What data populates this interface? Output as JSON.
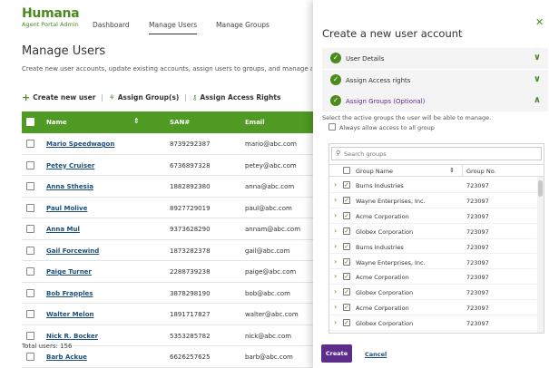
{
  "brand": {
    "name": "Humana",
    "subtitle": "Agent Portal Admin",
    "color": "#4b8b1e"
  },
  "nav": {
    "items": [
      "Dashboard",
      "Manage Users",
      "Manage Groups"
    ],
    "active": "Manage Users"
  },
  "page": {
    "title": "Manage Users",
    "description": "Create new user accounts, update existing accounts, assign users to groups, and manage access r"
  },
  "toolbar": {
    "create_label": "Create new user",
    "assign_groups_label": "Assign Group(s)",
    "assign_rights_label": "Assign Access Rights"
  },
  "table": {
    "headers": {
      "name": "Name",
      "san": "SAN#",
      "email": "Email"
    },
    "rows": [
      {
        "name": "Mario Speedwagon",
        "san": "8739292387",
        "email": "mario@abc.com"
      },
      {
        "name": "Petey Cruiser",
        "san": "6736897328",
        "email": "petey@abc.com"
      },
      {
        "name": "Anna Sthesia",
        "san": "1882892380",
        "email": "anna@abc.com"
      },
      {
        "name": "Paul Molive",
        "san": "8927729019",
        "email": "paul@abc.com"
      },
      {
        "name": "Anna Mul",
        "san": "9373628290",
        "email": "annam@abc.com"
      },
      {
        "name": "Gail Forcewind",
        "san": "1873282378",
        "email": "gail@abc.com"
      },
      {
        "name": "Paige Turner",
        "san": "2288739238",
        "email": "paige@abc.com"
      },
      {
        "name": "Bob Frapples",
        "san": "3878298190",
        "email": "bob@abc.com"
      },
      {
        "name": "Walter Melon",
        "san": "1891717827",
        "email": "walter@abc.com"
      },
      {
        "name": "Nick R. Bocker",
        "san": "5353285782",
        "email": "nick@abc.com"
      },
      {
        "name": "Barb Ackue",
        "san": "6626257625",
        "email": "barb@abc.com"
      }
    ],
    "total": "Total users: 156",
    "header_color": "#4e9a22"
  },
  "panel": {
    "title": "Create a new user account",
    "sections": [
      {
        "label": "User Details",
        "state": "collapsed"
      },
      {
        "label": "Assign Access rights",
        "state": "collapsed"
      },
      {
        "label": "Assign Groups (Optional)",
        "state": "expanded"
      }
    ],
    "groups_description": "Select the active groups the user will be able to manage.",
    "allow_all_label": "Always allow access to all group",
    "search_placeholder": "Search groups",
    "group_headers": {
      "name": "Group Name",
      "number": "Group No."
    },
    "groups": [
      {
        "name": "Burns Industries",
        "number": "723097"
      },
      {
        "name": "Wayne Enterprises, Inc.",
        "number": "723097"
      },
      {
        "name": "Acme Corporation",
        "number": "723097"
      },
      {
        "name": "Globex Corporation",
        "number": "723097"
      },
      {
        "name": "Burns Industries",
        "number": "723097"
      },
      {
        "name": "Wayne Enterprises, Inc.",
        "number": "723097"
      },
      {
        "name": "Acme Corporation",
        "number": "723097"
      },
      {
        "name": "Globex Corporation",
        "number": "723097"
      },
      {
        "name": "Acme Corporation",
        "number": "723097"
      },
      {
        "name": "Globex Corporation",
        "number": "723097"
      }
    ],
    "create_label": "Create",
    "cancel_label": "Cancel",
    "accent_color": "#5c2d8a"
  }
}
